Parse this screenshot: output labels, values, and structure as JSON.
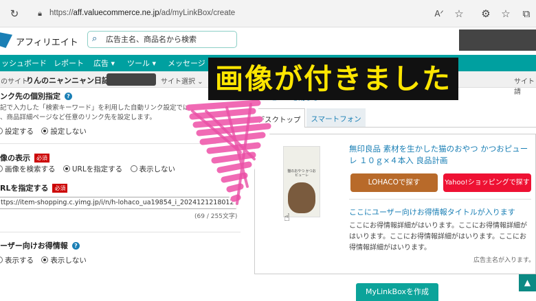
{
  "browser": {
    "url_prefix": "https://",
    "url_host": "aff.valuecommerce.ne.jp",
    "url_path": "/ad/myLinkBox/create",
    "icons": [
      "reload-icon",
      "lock-icon",
      "read-aloud-icon",
      "favorite-star-icon",
      "extensions-icon",
      "favorites-icon",
      "collections-icon"
    ]
  },
  "header": {
    "brand": "アフィリエイト",
    "search_placeholder": "広告主名、商品名から検索"
  },
  "nav": {
    "items": [
      "ッシュボード",
      "レポート",
      "広告 ▾",
      "ツール ▾",
      "メッセージ"
    ]
  },
  "subbar": {
    "prefix": "のサイト",
    "site_name": "りんのニャンニャン日記",
    "site_select": "サイト選択 ⌄",
    "site_right": "サイト請"
  },
  "form": {
    "auto_link": {
      "title": "ンク先の個別指定",
      "desc_line1": "記で入力した「検索キーワード」を利用した自動リンク設定ではなく、広",
      "desc_line2": "、商品詳細ページなど任意のリンク先を設定します。",
      "options": [
        "設定する",
        "設定しない"
      ],
      "selected": 1
    },
    "image_display": {
      "title": "像の表示",
      "required": "必須",
      "options": [
        "画像を検索する",
        "URLを指定する",
        "表示しない"
      ],
      "selected": 1
    },
    "url_spec": {
      "title": "RLを指定する",
      "required": "必須",
      "value": "ttps://item-shopping.c.yimg.jp/i/n/h-lohaco_ua19854_i_20241212180129",
      "count": "(69 / 255文字)"
    },
    "user_offer": {
      "title": "ーザー向けお得情報",
      "options": [
        "表示する",
        "表示しない"
      ],
      "selected": 1
    }
  },
  "preview": {
    "close_link": "プレビューを閉じる",
    "tabs": [
      "デスクトップ",
      "スマートフォン"
    ],
    "package_text": "猫のおやつ かつおピューレ",
    "product_title": "無印良品 素材を生かした猫のおやつ かつおピューレ １０ｇ×４本入 良品計画",
    "btn_lohaco": "LOHACOで探す",
    "btn_yahoo": "Yahoo!ショッピングで探す",
    "offer_title": "ここにユーザー向けお得情報タイトルが入ります",
    "offer_detail": "ここにお得情報詳細がはいります。ここにお得情報詳細がはいります。ここにお得情報詳細がはいります。ここにお得情報詳細がはいります。",
    "advertiser": "広告主名が入ります。"
  },
  "create_button": "MyLinkBoxを作成",
  "scroll_top": "▲",
  "overlay": {
    "caption": "画像が付きました"
  },
  "colors": {
    "nav_teal": "#00a0a0",
    "link_blue": "#1a7fb5",
    "lohaco_brown": "#b86a2a",
    "yahoo_red": "#ee1133",
    "caption_yellow": "#ffe600",
    "scribble_pink": "#f06ab4"
  }
}
